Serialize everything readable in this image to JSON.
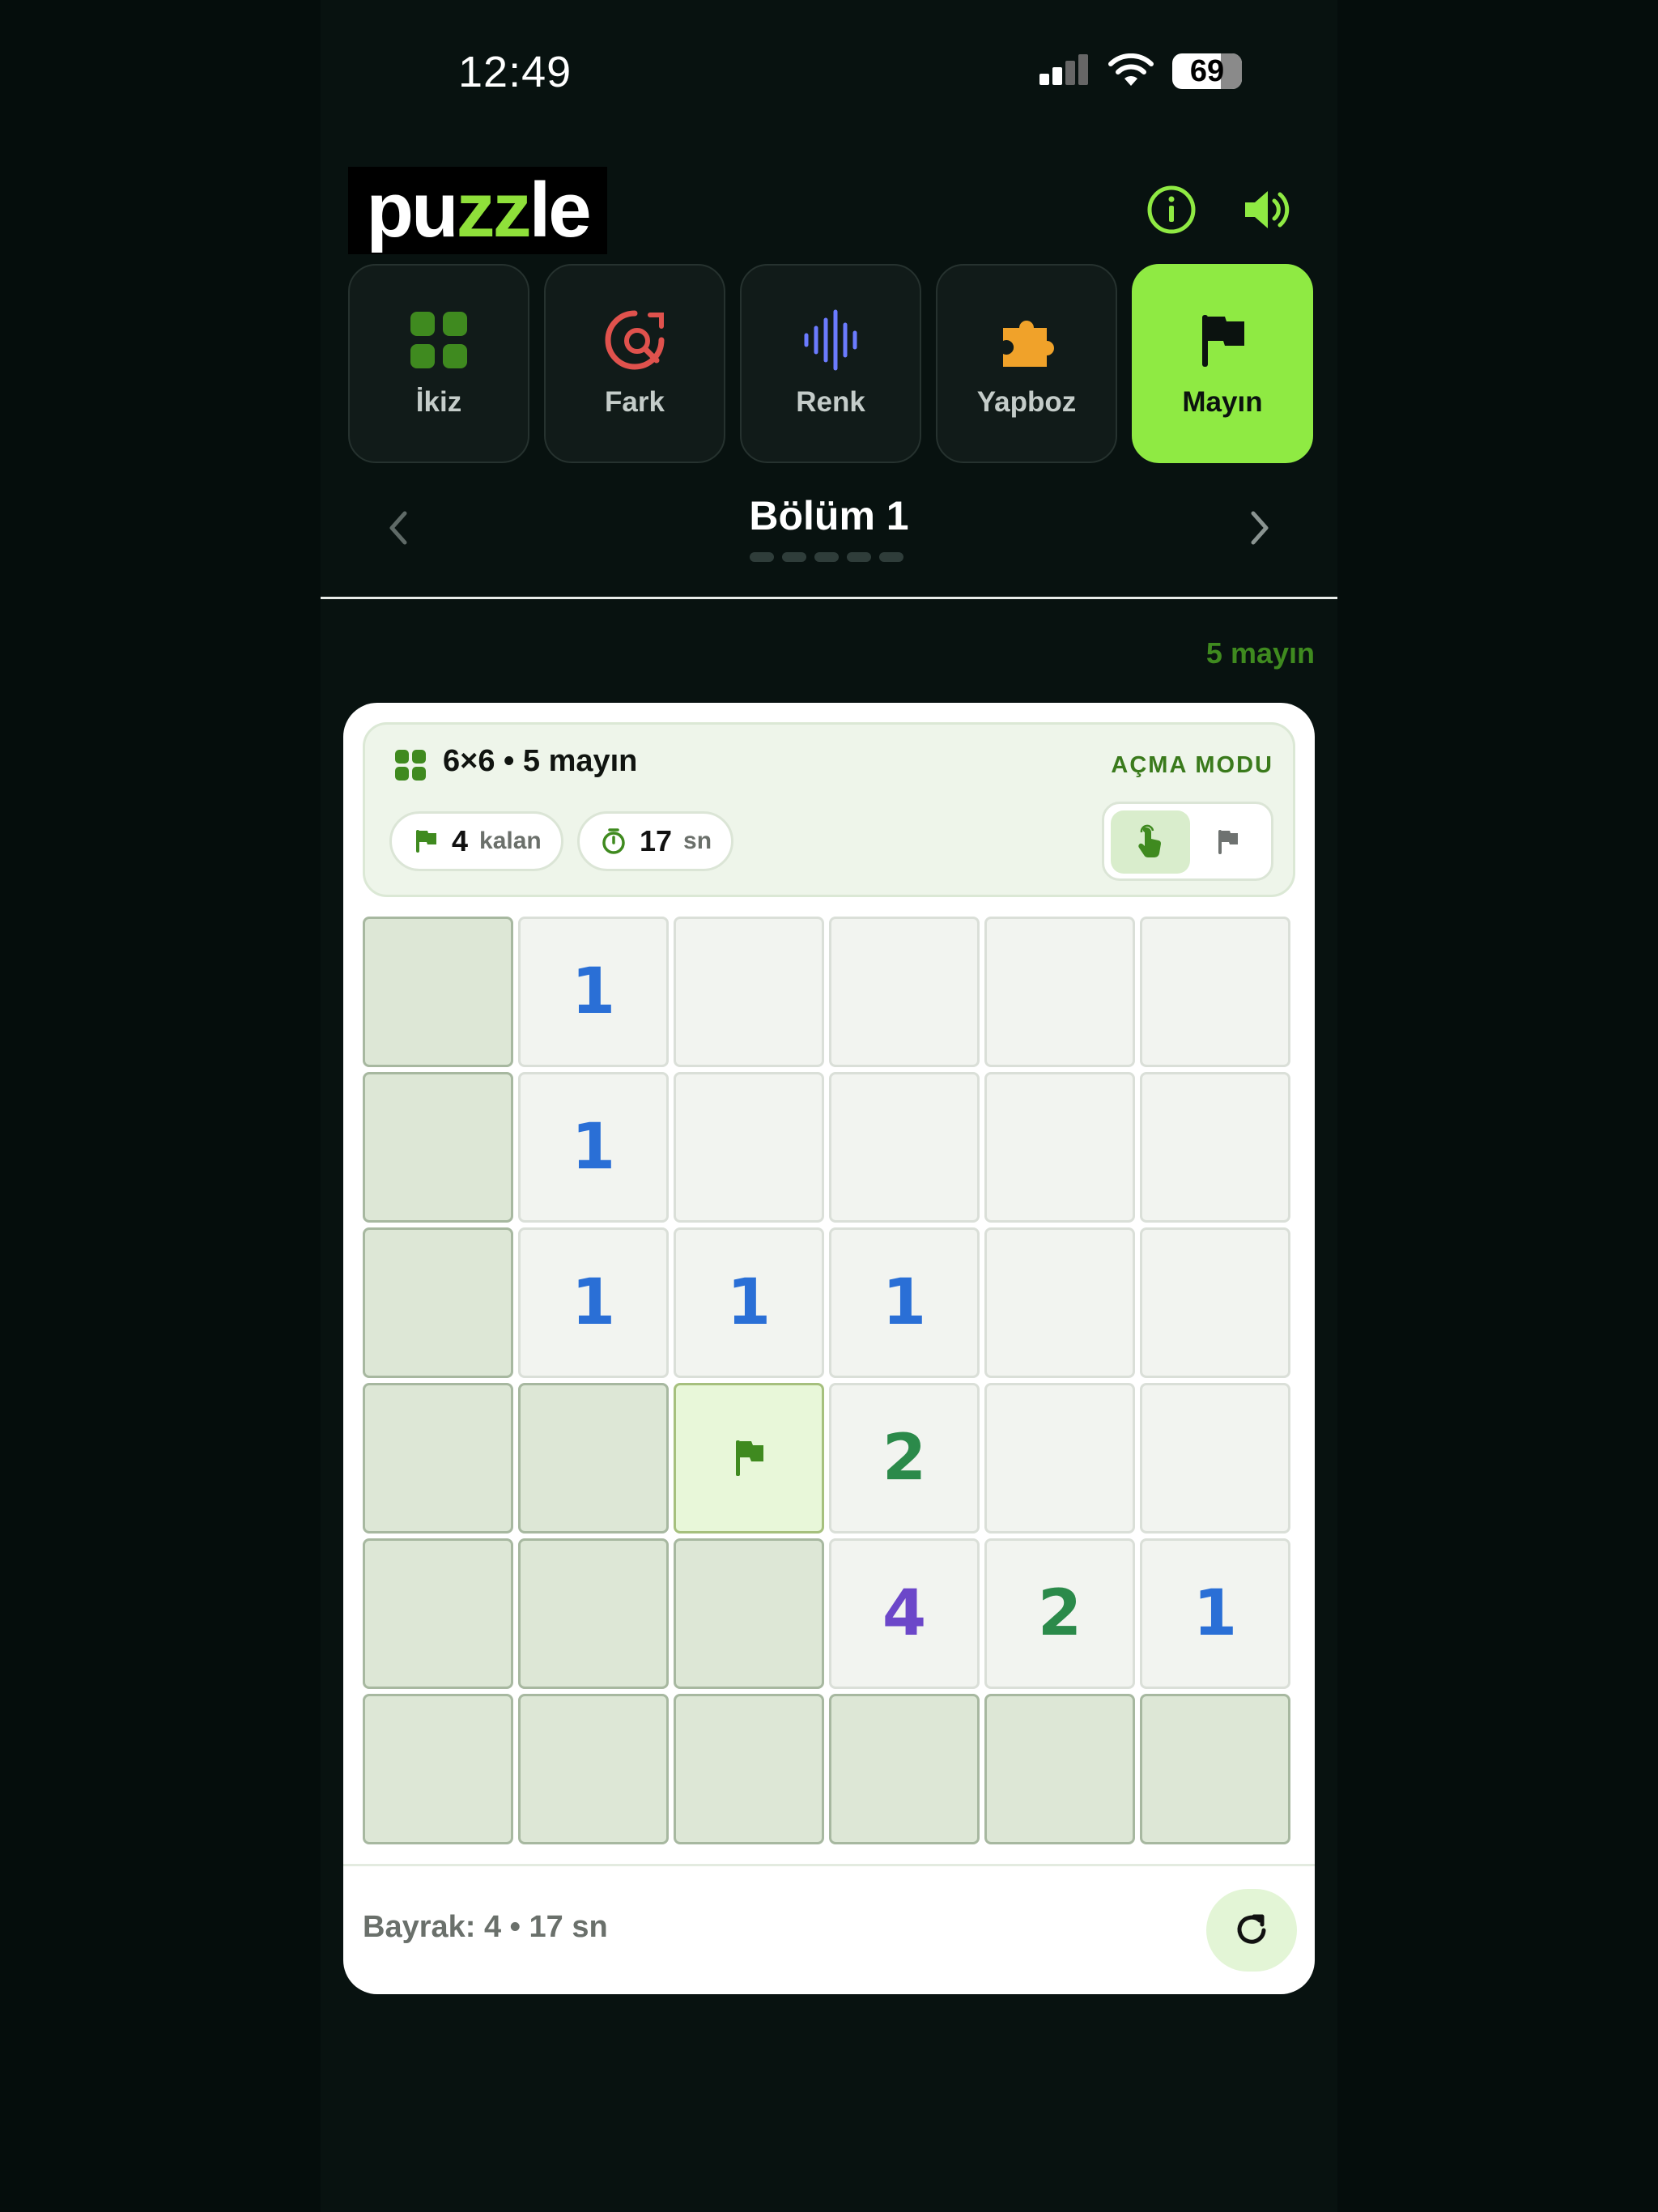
{
  "status_bar": {
    "time": "12:49",
    "battery": "69",
    "battery_level_percent": 69
  },
  "header": {
    "logo_prefix": "pu",
    "logo_accent": "zz",
    "logo_suffix": "le"
  },
  "tabs": [
    {
      "label": "İkiz",
      "icon": "grid-icon",
      "color": "#3f8a1f"
    },
    {
      "label": "Fark",
      "icon": "search-diff-icon",
      "color": "#e0524d"
    },
    {
      "label": "Renk",
      "icon": "soundwave-icon",
      "color": "#6b7bff"
    },
    {
      "label": "Yapboz",
      "icon": "puzzle-piece-icon",
      "color": "#f0a22a"
    },
    {
      "label": "Mayın",
      "icon": "flag-icon",
      "color": "#0b120f",
      "active": true
    }
  ],
  "level": {
    "title": "Bölüm 1",
    "page_count": 5
  },
  "mine_summary": "5 mayın",
  "game": {
    "title": "6×6 • 5 mayın",
    "mode_label": "AÇMA MODU",
    "flags_left": "4",
    "flags_left_unit": "kalan",
    "timer": "17",
    "timer_unit": "sn",
    "board": [
      [
        "H",
        "1",
        "O",
        "O",
        "O",
        "O"
      ],
      [
        "H",
        "1",
        "O",
        "O",
        "O",
        "O"
      ],
      [
        "H",
        "1",
        "1",
        "1",
        "O",
        "O"
      ],
      [
        "H",
        "H",
        "F",
        "2",
        "O",
        "O"
      ],
      [
        "H",
        "H",
        "H",
        "4",
        "2",
        "1"
      ],
      [
        "H",
        "H",
        "H",
        "H",
        "H",
        "H"
      ]
    ],
    "number_colors": {
      "1": "#2a6fd6",
      "2": "#2b8a4a",
      "4": "#6c47c9"
    },
    "footer": "Bayrak: 4 • 17 sn"
  },
  "colors": {
    "accent": "#8fea43",
    "dark_green": "#3f8a1f",
    "background": "#081210"
  }
}
